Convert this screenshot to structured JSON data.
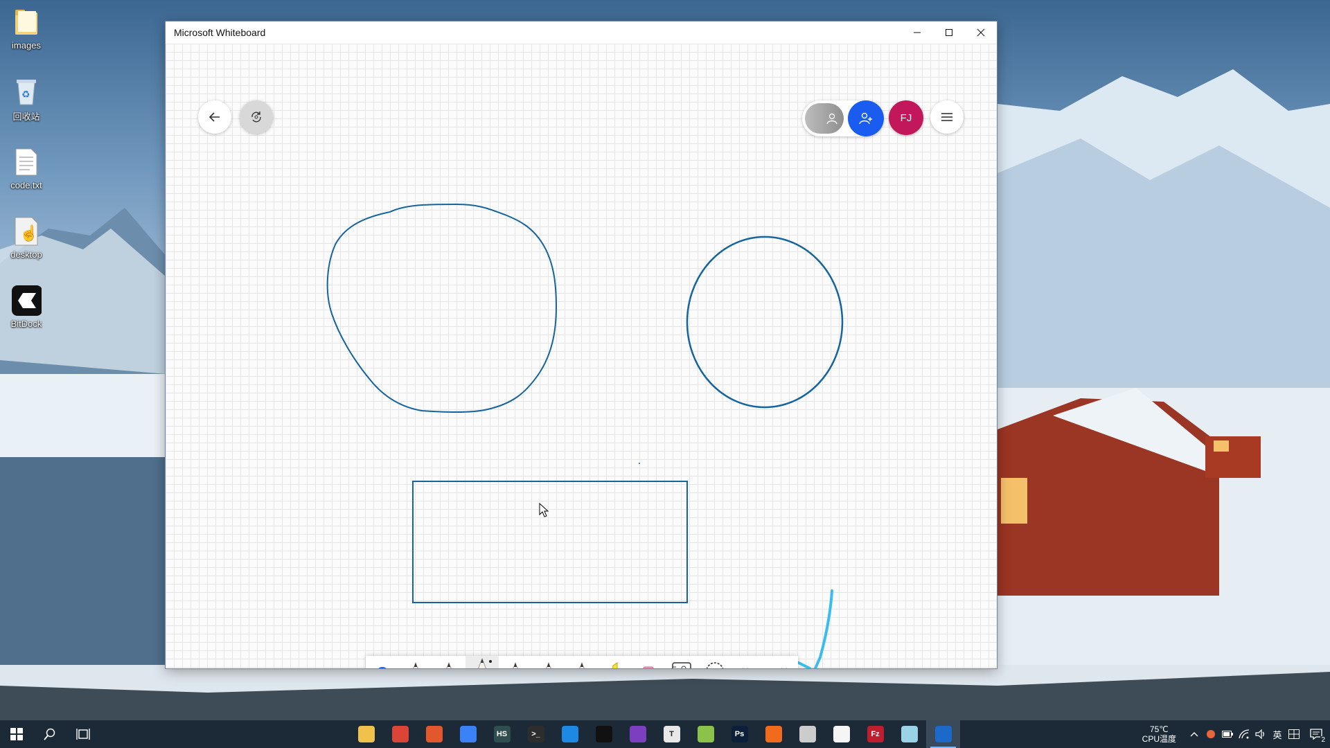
{
  "desktop": {
    "icons": [
      {
        "label": "images",
        "icon": "folder-icon"
      },
      {
        "label": "回收站",
        "icon": "recycle-bin-icon"
      },
      {
        "label": "code.txt",
        "icon": "text-file-icon"
      },
      {
        "label": "desktop",
        "icon": "shortcut-icon"
      },
      {
        "label": "BitDock",
        "icon": "bitdock-icon"
      }
    ]
  },
  "window": {
    "title": "Microsoft Whiteboard",
    "controls": [
      "minimize-icon",
      "maximize-icon",
      "close-icon"
    ]
  },
  "whiteboard": {
    "avatar_initials": "FJ",
    "ink_color": "#1464a0",
    "highlight_ink_color": "#3bbcf0",
    "toolbar": [
      {
        "name": "select-tool",
        "icon": "check-circle-icon"
      },
      {
        "name": "pen-yellow",
        "icon": "pen-icon",
        "color": "#f2b900"
      },
      {
        "name": "pen-red",
        "icon": "pen-icon",
        "color": "#e03a2f"
      },
      {
        "name": "pen-blue",
        "icon": "pen-icon",
        "color": "#1464a0",
        "selected": true
      },
      {
        "name": "pen-lightblue",
        "icon": "pen-icon",
        "color": "#3bbcf0"
      },
      {
        "name": "pen-red-2",
        "icon": "pen-icon",
        "color": "#e8423b"
      },
      {
        "name": "pen-rainbow",
        "icon": "pen-icon",
        "color": "#4caf50"
      },
      {
        "name": "highlighter",
        "icon": "highlighter-icon",
        "color": "#f5e53b"
      },
      {
        "name": "eraser",
        "icon": "eraser-icon",
        "color": "#f29bc0"
      },
      {
        "name": "ruler",
        "icon": "ruler-icon"
      },
      {
        "name": "lasso",
        "icon": "lasso-icon"
      },
      {
        "name": "undo",
        "icon": "undo-icon"
      },
      {
        "name": "redo",
        "icon": "redo-icon"
      }
    ]
  },
  "taskbar": {
    "apps": [
      {
        "icon": "file-explorer-icon",
        "color": "#f1c24b",
        "text": ""
      },
      {
        "icon": "chrome-icon",
        "color": "#db4437",
        "text": ""
      },
      {
        "icon": "app-orange-icon",
        "color": "#e2572c",
        "text": ""
      },
      {
        "icon": "app-blue-icon",
        "color": "#3b82f6",
        "text": ""
      },
      {
        "icon": "hs-icon",
        "color": "#2f4f4f",
        "text": "HS"
      },
      {
        "icon": "terminal-icon",
        "color": "#2d2d2d",
        "text": ">_"
      },
      {
        "icon": "vscode-icon",
        "color": "#1e88e5",
        "text": ""
      },
      {
        "icon": "qq-icon",
        "color": "#111111",
        "text": ""
      },
      {
        "icon": "visual-studio-icon",
        "color": "#7b3fbf",
        "text": ""
      },
      {
        "icon": "typora-icon",
        "color": "#e8e8e8",
        "text": "T"
      },
      {
        "icon": "app-green-icon",
        "color": "#8bc34a",
        "text": ""
      },
      {
        "icon": "photoshop-icon",
        "color": "#0b1e3a",
        "text": "Ps"
      },
      {
        "icon": "app-orange2-icon",
        "color": "#f26b1d",
        "text": ""
      },
      {
        "icon": "app-avatar-icon",
        "color": "#cccccc",
        "text": ""
      },
      {
        "icon": "file-icon",
        "color": "#f5f5f5",
        "text": ""
      },
      {
        "icon": "filezilla-icon",
        "color": "#bf1e2e",
        "text": "Fz"
      },
      {
        "icon": "notes-icon",
        "color": "#9ad2e8",
        "text": ""
      },
      {
        "icon": "whiteboard-icon",
        "color": "#1b6ac9",
        "text": "",
        "active": true
      }
    ],
    "temp": "75℃",
    "temp_label": "CPU温度",
    "ime": "英",
    "notification_count": "2"
  }
}
